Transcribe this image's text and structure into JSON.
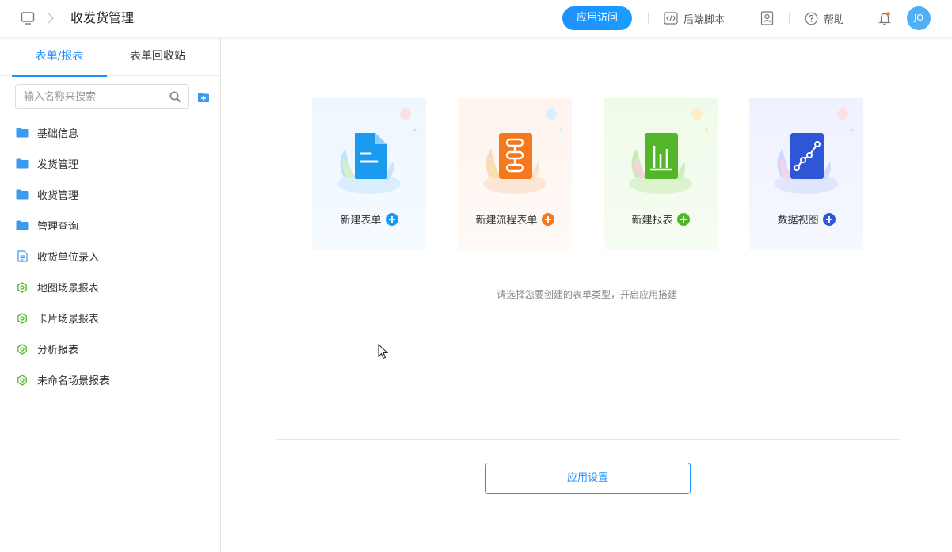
{
  "header": {
    "app_title": "收发货管理",
    "visit_button": "应用访问",
    "backend_script": "后端脚本",
    "help": "帮助",
    "avatar_initials": "JO",
    "accent_color": "#1e90ff"
  },
  "sidebar": {
    "tabs": [
      {
        "label": "表单/报表",
        "active": true
      },
      {
        "label": "表单回收站",
        "active": false
      }
    ],
    "search": {
      "placeholder": "输入名称来搜索",
      "value": ""
    },
    "items": [
      {
        "label": "基础信息",
        "icon": "folder-icon"
      },
      {
        "label": "发货管理",
        "icon": "folder-icon"
      },
      {
        "label": "收货管理",
        "icon": "folder-icon"
      },
      {
        "label": "管理查询",
        "icon": "folder-icon"
      },
      {
        "label": "收货单位录入",
        "icon": "form-document-icon"
      },
      {
        "label": "地图场景报表",
        "icon": "scene-report-icon"
      },
      {
        "label": "卡片场景报表",
        "icon": "scene-report-icon"
      },
      {
        "label": "分析报表",
        "icon": "scene-report-icon"
      },
      {
        "label": "未命名场景报表",
        "icon": "scene-report-icon"
      }
    ]
  },
  "main": {
    "cards": [
      {
        "label": "新建表单",
        "icon": "form-document-icon",
        "color": "#1a9bf0"
      },
      {
        "label": "新建流程表单",
        "icon": "workflow-icon",
        "color": "#f5781f"
      },
      {
        "label": "新建报表",
        "icon": "bar-chart-icon",
        "color": "#52b52a"
      },
      {
        "label": "数据视图",
        "icon": "line-chart-icon",
        "color": "#2f56d6"
      }
    ],
    "hint": "请选择您要创建的表单类型，开启应用搭建",
    "settings_button": "应用设置"
  }
}
